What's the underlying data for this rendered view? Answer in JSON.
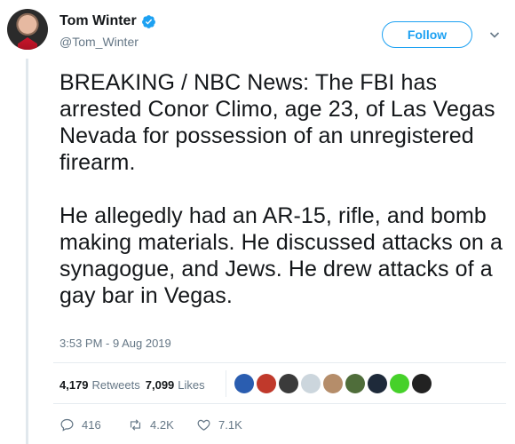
{
  "tweet": {
    "author": {
      "display_name": "Tom Winter",
      "handle": "@Tom_Winter",
      "verified": true
    },
    "follow_label": "Follow",
    "text": "BREAKING / NBC News: The FBI has arrested Conor Climo, age 23, of Las Vegas Nevada for possession of an unregistered firearm.\n\nHe allegedly had an AR-15, rifle, and bomb making materials. He discussed attacks on a synagogue, and Jews. He drew attacks of a gay bar in Vegas.",
    "timestamp": "3:53 PM - 9 Aug 2019",
    "stats": {
      "retweets_count": "4,179",
      "retweets_label": "Retweets",
      "likes_count": "7,099",
      "likes_label": "Likes"
    },
    "liked_by": [
      {
        "name": "liker-1",
        "color": "#2a5db0"
      },
      {
        "name": "liker-2",
        "color": "#c0392b"
      },
      {
        "name": "liker-3",
        "color": "#3b3b3b"
      },
      {
        "name": "liker-4",
        "color": "#ccd6dd"
      },
      {
        "name": "liker-5",
        "color": "#b58d6a"
      },
      {
        "name": "liker-6",
        "color": "#4f6d3a"
      },
      {
        "name": "liker-7",
        "color": "#1e2a3a"
      },
      {
        "name": "liker-8",
        "color": "#46d12a"
      },
      {
        "name": "liker-9",
        "color": "#222222"
      }
    ],
    "actions": {
      "replies": "416",
      "retweets": "4.2K",
      "likes": "7.1K"
    },
    "colors": {
      "accent": "#1da1f2",
      "muted": "#657786",
      "text": "#14171a",
      "border": "#e6ecf0"
    }
  }
}
